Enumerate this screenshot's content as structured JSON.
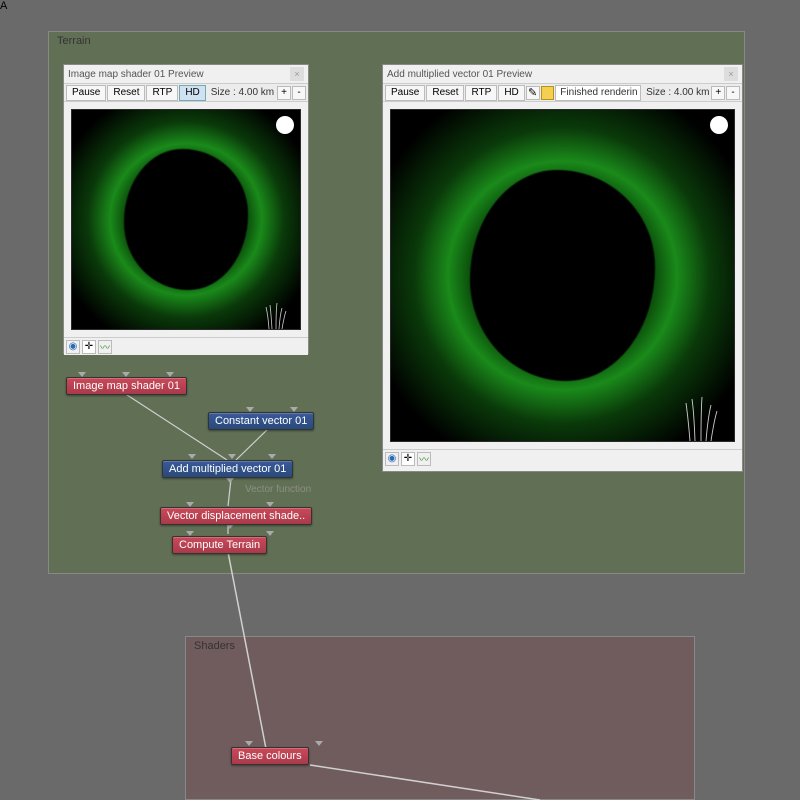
{
  "panels": {
    "terrain": {
      "title": "Terrain"
    },
    "shaders": {
      "title": "Shaders"
    }
  },
  "preview_left": {
    "title": "Image map shader 01 Preview",
    "buttons": {
      "pause": "Pause",
      "reset": "Reset",
      "rtp": "RTP",
      "hd": "HD",
      "plus": "+",
      "minus": "-"
    },
    "size_label": "Size : 4.00 km"
  },
  "preview_right": {
    "title": "Add multiplied vector 01 Preview",
    "buttons": {
      "pause": "Pause",
      "reset": "Reset",
      "rtp": "RTP",
      "hd": "HD",
      "plus": "+",
      "minus": "-"
    },
    "status": "Finished renderin",
    "size_label": "Size : 4.00 km"
  },
  "nodes": {
    "image_map": "Image map shader 01",
    "constant_vec": "Constant vector 01",
    "add_mult": "Add multiplied vector 01",
    "vec_disp": "Vector displacement shade..",
    "compute_terrain": "Compute Terrain",
    "base_colours": "Base colours",
    "a_badge": "A",
    "vector_function": "Vector function"
  }
}
